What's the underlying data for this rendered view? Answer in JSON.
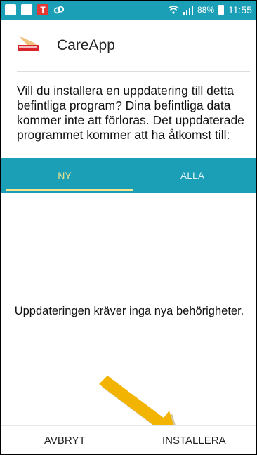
{
  "status_bar": {
    "battery_percent": "88%",
    "time": "11:55",
    "icons": [
      "image-icon",
      "message-icon",
      "t-app-icon",
      "link-icon",
      "wifi-icon",
      "signal-icon",
      "battery-icon"
    ]
  },
  "app": {
    "name": "CareApp",
    "icon": "careapp-logo-icon"
  },
  "install_prompt": {
    "question": "Vill du installera en uppdatering till detta befintliga program? Dina befintliga data kommer inte att förloras. Det uppdaterade programmet kommer att ha åtkomst till:"
  },
  "tabs": [
    {
      "label": "NY",
      "selected": true
    },
    {
      "label": "ALLA",
      "selected": false
    }
  ],
  "permissions_message": "Uppdateringen kräver inga nya behörigheter.",
  "buttons": {
    "cancel": "AVBRYT",
    "install": "INSTALLERA"
  },
  "colors": {
    "accent": "#1a9fb6",
    "tab_selected": "#f6e58d",
    "annotation_arrow": "#f2b400"
  }
}
